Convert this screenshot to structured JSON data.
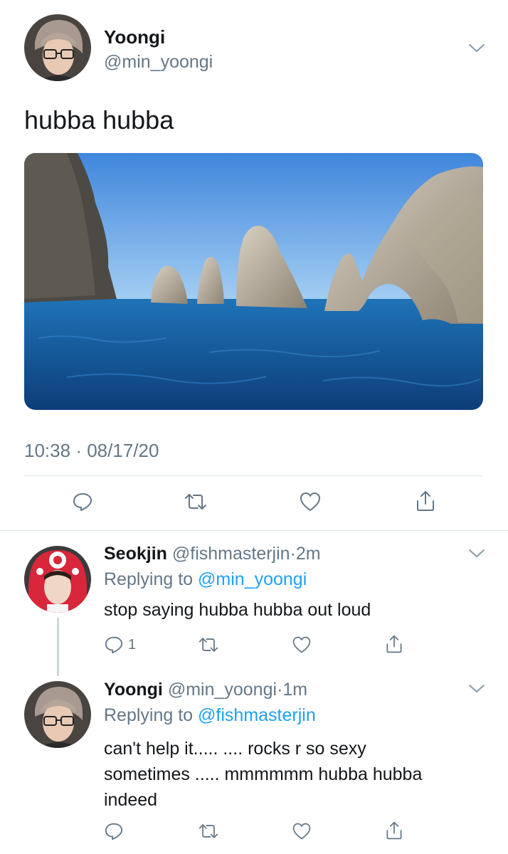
{
  "tweet": {
    "author_name": "Yoongi",
    "author_handle": "@min_yoongi",
    "text": "hubba hubba",
    "time": "10:38",
    "date": "08/17/20",
    "sep": "·"
  },
  "replies": [
    {
      "name": "Seokjin",
      "handle": "@fishmasterjin",
      "sep": "·",
      "age": "2m",
      "replying_label": "Replying to",
      "replying_to": "@min_yoongi",
      "text": "stop saying hubba hubba out loud",
      "reply_count": "1"
    },
    {
      "name": "Yoongi",
      "handle": "@min_yoongi",
      "sep": "·",
      "age": "1m",
      "replying_label": "Replying to",
      "replying_to": "@fishmasterjin",
      "text_line1": "can't help it..... .... rocks r so sexy",
      "text_line2": "sometimes ..... mmmmmm hubba hubba",
      "text_line3": "indeed"
    }
  ],
  "colors": {
    "accent": "#1da1f2",
    "muted": "#657786",
    "divider": "#e1e8ed"
  }
}
